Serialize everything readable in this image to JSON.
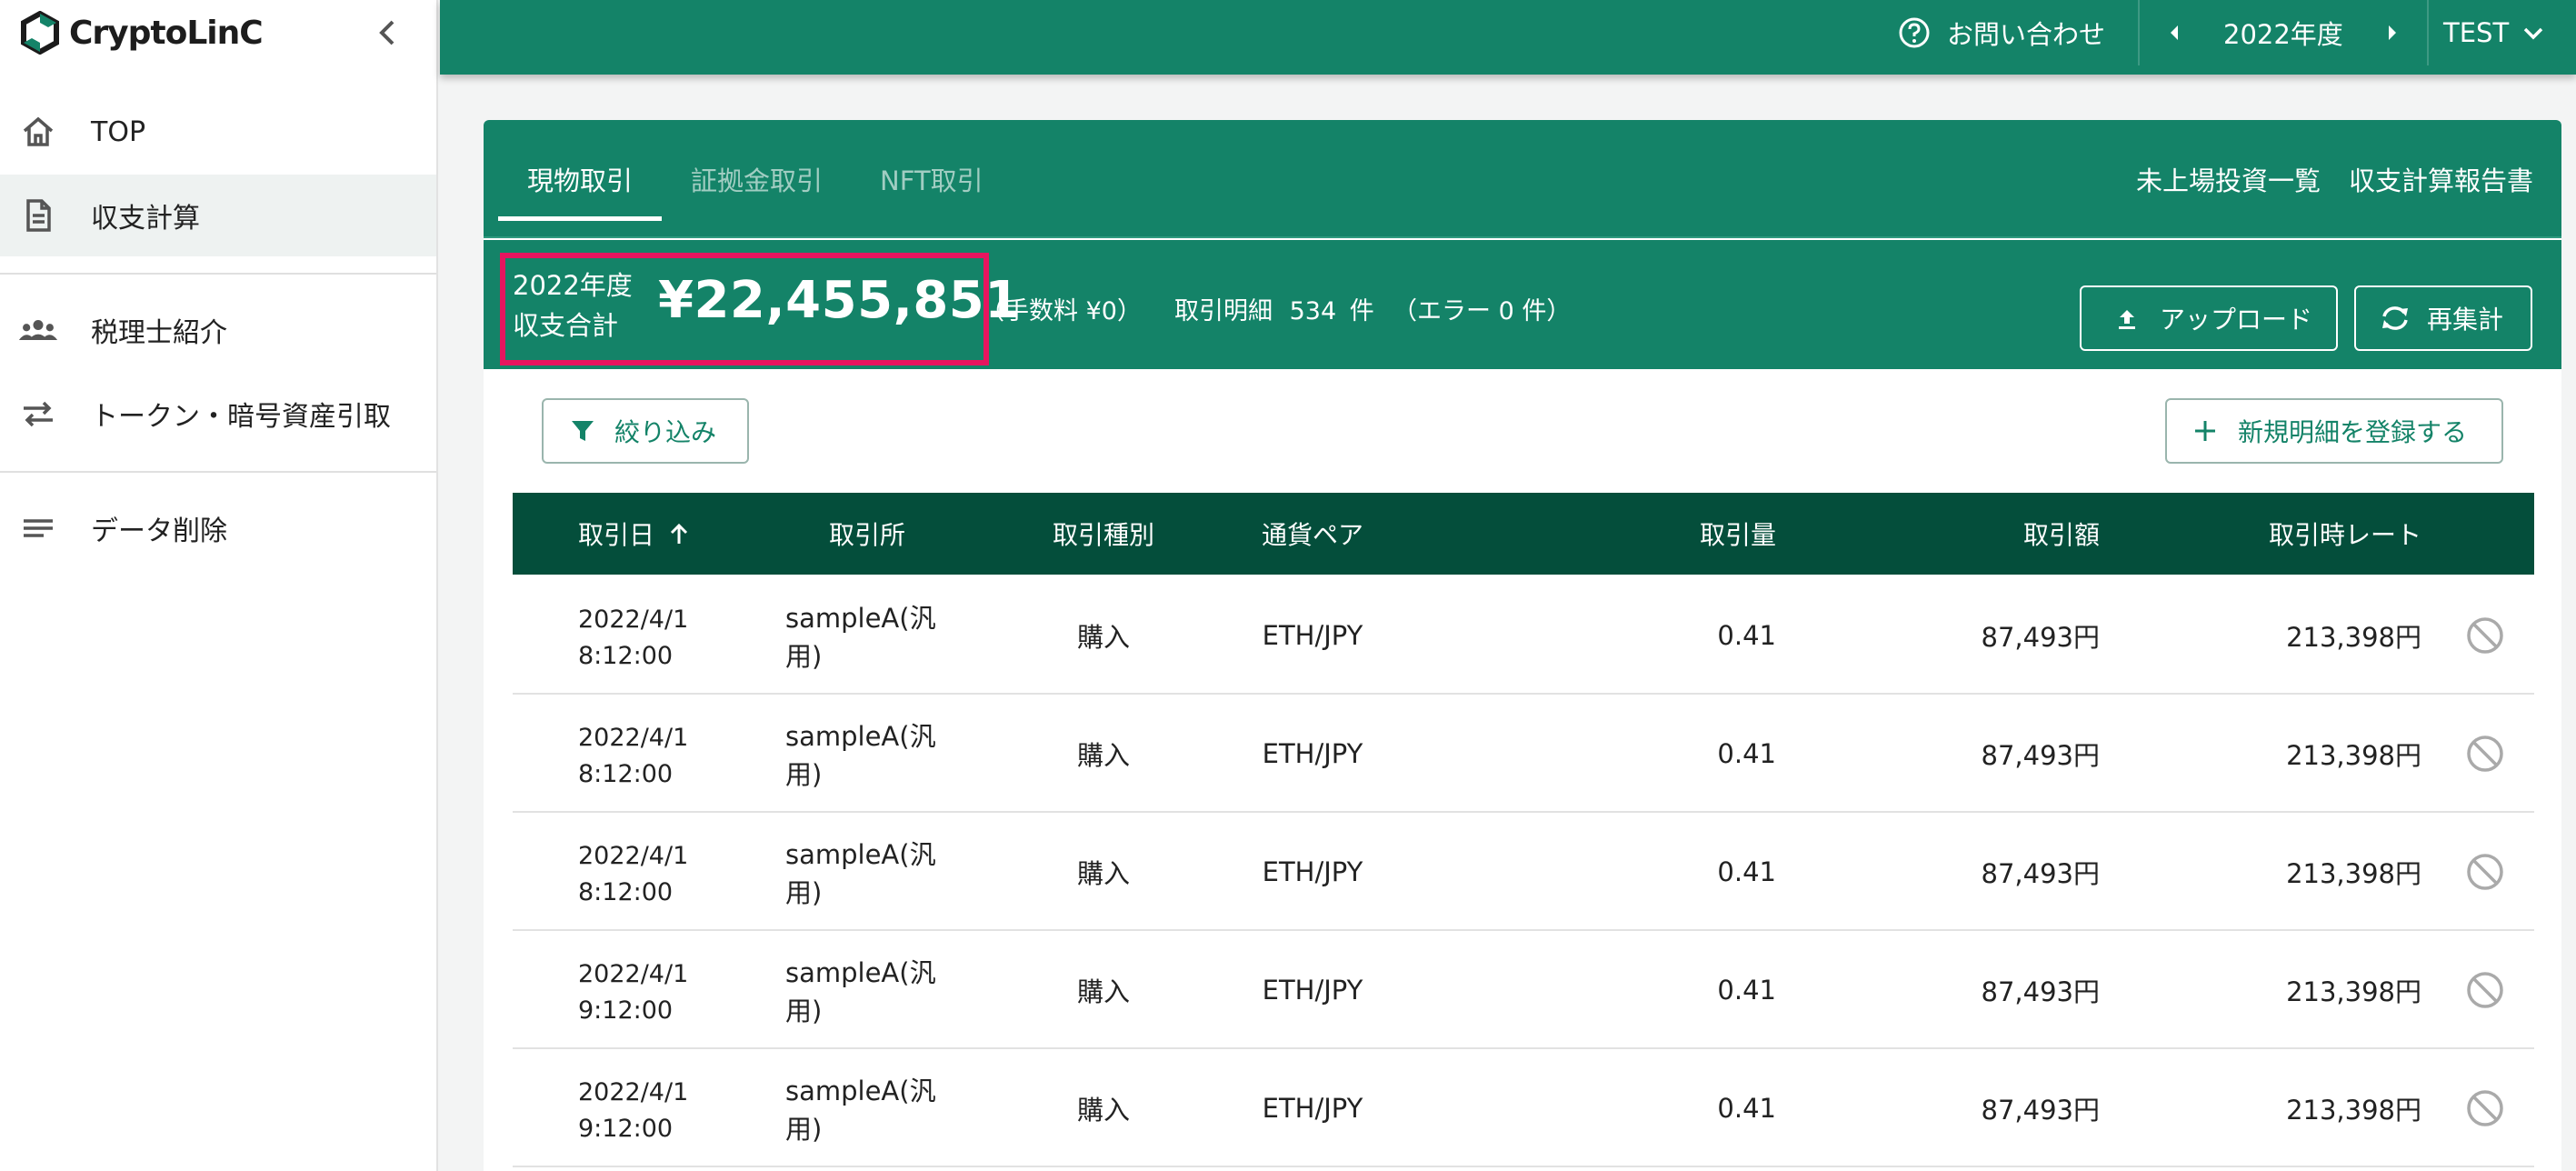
{
  "sidebar": {
    "logo_text": "CryptoLinC",
    "items": [
      {
        "label": "TOP",
        "icon": "home-icon"
      },
      {
        "label": "収支計算",
        "icon": "document-icon"
      },
      {
        "label": "税理士紹介",
        "icon": "people-icon"
      },
      {
        "label": "トークン・暗号資産引取",
        "icon": "swap-arrows-icon"
      },
      {
        "label": "データ削除",
        "icon": "lines-icon"
      }
    ]
  },
  "header": {
    "contact_label": "お問い合わせ",
    "year_label": "2022年度",
    "user_label": "TEST"
  },
  "tabs": [
    {
      "label": "現物取引"
    },
    {
      "label": "証拠金取引"
    },
    {
      "label": "NFT取引"
    }
  ],
  "links": {
    "unlisted": "未上場投資一覧",
    "report": "収支計算報告書"
  },
  "summary": {
    "year": "2022年度",
    "total_label": "収支合計",
    "total_value": "¥22,455,851",
    "fee": "（手数料 ¥0）",
    "detail_label": "取引明細",
    "detail_count": "534",
    "detail_unit": "件",
    "error": "（エラー 0 件）"
  },
  "buttons": {
    "upload": "アップロード",
    "recalc": "再集計",
    "filter": "絞り込み",
    "new_entry": "新規明細を登録する"
  },
  "table": {
    "columns": [
      "取引日",
      "取引所",
      "取引種別",
      "通貨ペア",
      "取引量",
      "取引額",
      "取引時レート"
    ],
    "rows": [
      {
        "date": "2022/4/1",
        "time": "8:12:00",
        "exchange": "sampleA(汎用)",
        "type": "購入",
        "pair": "ETH/JPY",
        "amount": "0.41",
        "value": "87,493円",
        "rate": "213,398円"
      },
      {
        "date": "2022/4/1",
        "time": "8:12:00",
        "exchange": "sampleA(汎用)",
        "type": "購入",
        "pair": "ETH/JPY",
        "amount": "0.41",
        "value": "87,493円",
        "rate": "213,398円"
      },
      {
        "date": "2022/4/1",
        "time": "8:12:00",
        "exchange": "sampleA(汎用)",
        "type": "購入",
        "pair": "ETH/JPY",
        "amount": "0.41",
        "value": "87,493円",
        "rate": "213,398円"
      },
      {
        "date": "2022/4/1",
        "time": "9:12:00",
        "exchange": "sampleA(汎用)",
        "type": "購入",
        "pair": "ETH/JPY",
        "amount": "0.41",
        "value": "87,493円",
        "rate": "213,398円"
      },
      {
        "date": "2022/4/1",
        "time": "9:12:00",
        "exchange": "sampleA(汎用)",
        "type": "購入",
        "pair": "ETH/JPY",
        "amount": "0.41",
        "value": "87,493円",
        "rate": "213,398円"
      }
    ]
  },
  "colors": {
    "primary": "#148368",
    "header_dark": "#044e3b",
    "highlight": "#e6155f"
  }
}
